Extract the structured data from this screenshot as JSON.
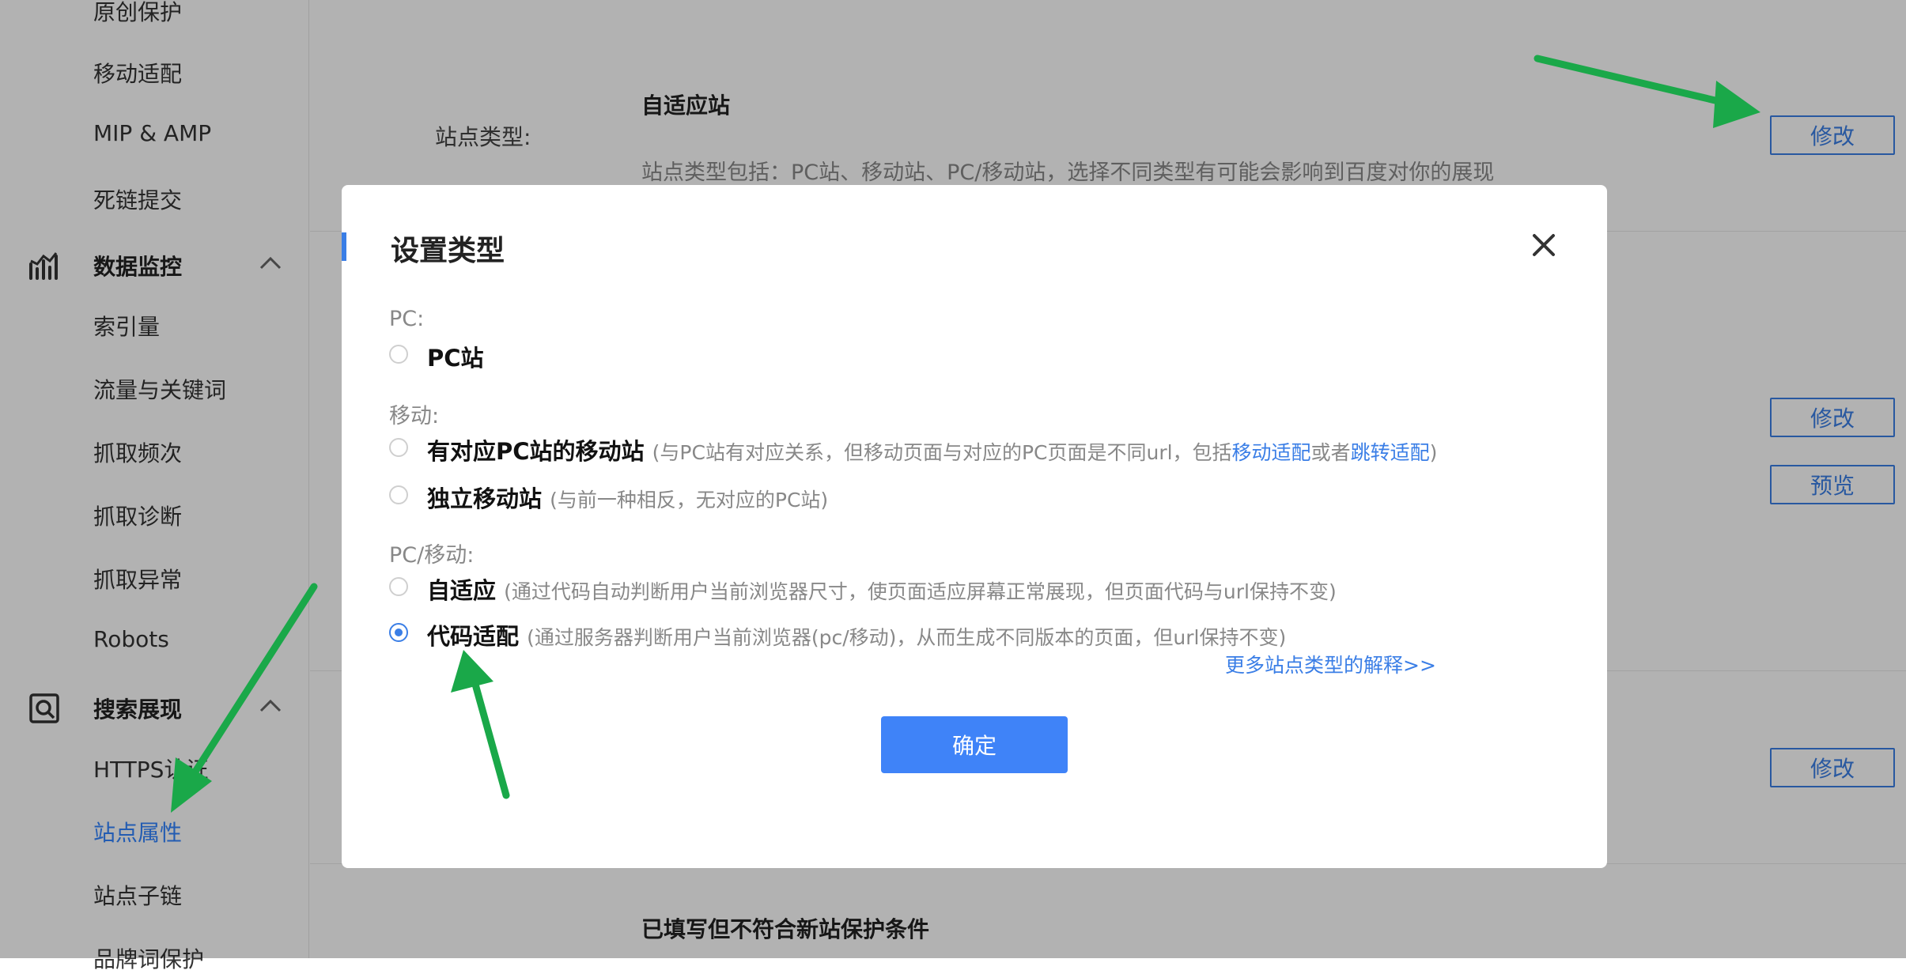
{
  "sidebar": {
    "items_top": [
      "原创保护",
      "移动适配",
      "MIP & AMP",
      "死链提交"
    ],
    "group1": {
      "label": "数据监控",
      "icon": "chart-icon",
      "items": [
        "索引量",
        "流量与关键词",
        "抓取频次",
        "抓取诊断",
        "抓取异常",
        "Robots"
      ]
    },
    "group2": {
      "label": "搜索展现",
      "icon": "search-display-icon",
      "items": [
        "HTTPS认证",
        "站点属性",
        "站点子链",
        "品牌词保护"
      ]
    },
    "active_item": "站点属性"
  },
  "main": {
    "site_type_label": "站点类型:",
    "site_type_value": "自适应站",
    "site_type_desc": "站点类型包括：PC站、移动站、PC/移动站，选择不同类型有可能会影响到百度对你的展现",
    "buttons": {
      "modify": "修改",
      "preview": "预览"
    },
    "bottom_text": "已填写但不符合新站保护条件"
  },
  "modal": {
    "title": "设置类型",
    "sections": [
      {
        "label": "PC:",
        "options": [
          {
            "label": "PC站",
            "desc": "",
            "checked": false
          }
        ]
      },
      {
        "label": "移动:",
        "options": [
          {
            "label": "有对应PC站的移动站",
            "desc_pre": "(与PC站有对应关系，但移动页面与对应的PC页面是不同url，包括",
            "link1": "移动适配",
            "desc_mid": "或者",
            "link2": "跳转适配",
            "desc_post": ")",
            "checked": false
          },
          {
            "label": "独立移动站",
            "desc": "(与前一种相反，无对应的PC站)",
            "checked": false
          }
        ]
      },
      {
        "label": "PC/移动:",
        "options": [
          {
            "label": "自适应",
            "desc": "(通过代码自动判断用户当前浏览器尺寸，使页面适应屏幕正常展现，但页面代码与url保持不变)",
            "checked": false
          },
          {
            "label": "代码适配",
            "desc": "(通过服务器判断用户当前浏览器(pc/移动)，从而生成不同版本的页面，但url保持不变)",
            "checked": true
          }
        ]
      }
    ],
    "more_link": "更多站点类型的解释>>",
    "confirm": "确定"
  },
  "colors": {
    "accent": "#3a7ee6",
    "confirm": "#3f83f8",
    "arrow": "#1aa849"
  }
}
